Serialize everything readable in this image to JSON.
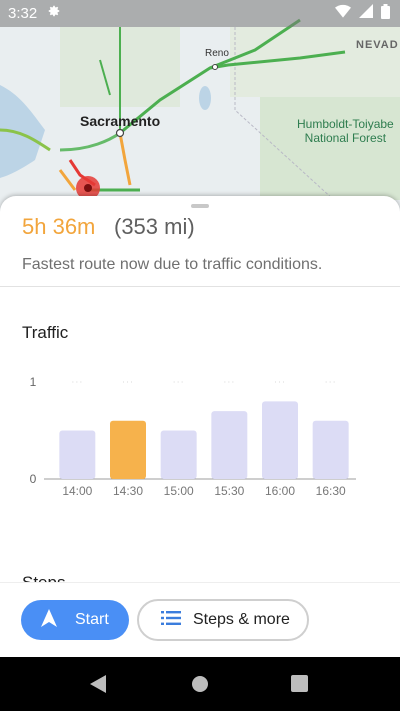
{
  "status_bar": {
    "time": "3:32",
    "icons": [
      "gear-icon",
      "wifi-icon",
      "signal-icon",
      "battery-icon"
    ]
  },
  "map": {
    "labels": {
      "sacramento": "Sacramento",
      "reno": "Reno",
      "nevada": "NEVAD",
      "forest_line1": "Humboldt-Toiyabe",
      "forest_line2": "National Forest"
    }
  },
  "summary": {
    "duration": "5h 36m",
    "distance": "(353 mi)",
    "note": "Fastest route now due to traffic conditions."
  },
  "traffic": {
    "title": "Traffic"
  },
  "next_section": {
    "title": "Steps"
  },
  "actions": {
    "start_label": "Start",
    "steps_label": "Steps & more"
  },
  "colors": {
    "accent_time": "#f2a53c",
    "bar_default": "#dcdcf5",
    "bar_highlight": "#f6b24c",
    "start_button": "#4a8ff5"
  },
  "chart_data": {
    "type": "bar",
    "title": "Traffic",
    "categories": [
      "14:00",
      "14:30",
      "15:00",
      "15:30",
      "16:00",
      "16:30"
    ],
    "values": [
      0.5,
      0.6,
      0.5,
      0.7,
      0.8,
      0.6
    ],
    "highlight_index": 1,
    "ylim": [
      0,
      1
    ],
    "yticks": [
      "0",
      "1"
    ],
    "grid": true
  }
}
